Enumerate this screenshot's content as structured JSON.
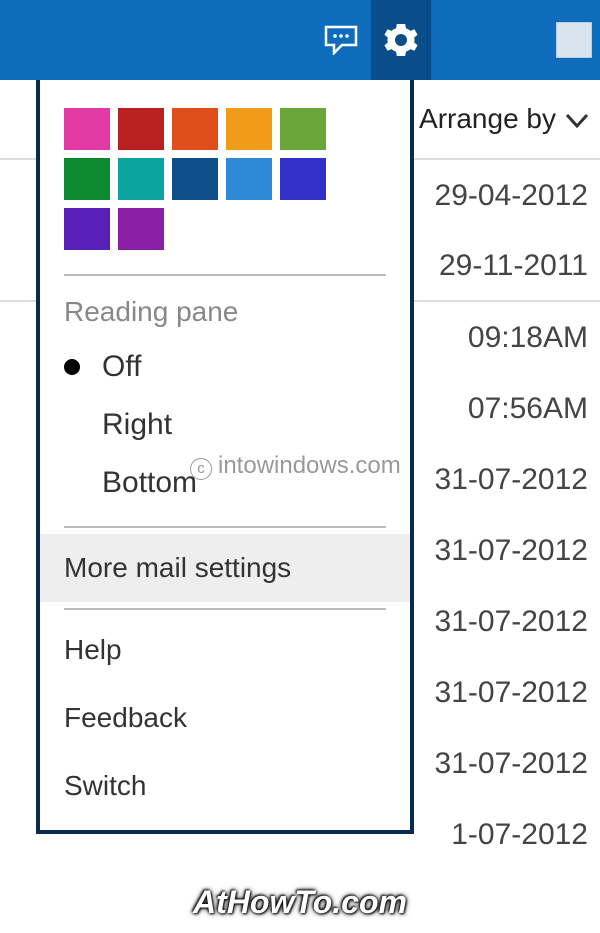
{
  "header": {
    "accent": "#0f6cbd",
    "accent_active": "#0a4d8c"
  },
  "arrange_by": {
    "label": "Arrange by"
  },
  "mail_list": {
    "rows": [
      "29-04-2012",
      "29-11-2011",
      "09:18AM",
      "07:56AM",
      "31-07-2012",
      "31-07-2012",
      "31-07-2012",
      "31-07-2012",
      "31-07-2012",
      "1-07-2012"
    ]
  },
  "settings_menu": {
    "theme_colors": [
      "#e23aa5",
      "#b92020",
      "#e04e1c",
      "#f19b1a",
      "#6aa53a",
      "#0d8a2e",
      "#0aa39e",
      "#0e4f8a",
      "#2f8ad6",
      "#3131c9",
      "#5a1eb9",
      "#8a1ea5"
    ],
    "reading_pane": {
      "title": "Reading pane",
      "options": {
        "off": "Off",
        "right": "Right",
        "bottom": "Bottom"
      },
      "selected": "off"
    },
    "more_settings": "More mail settings",
    "help": "Help",
    "feedback": "Feedback",
    "switch": "Switch"
  },
  "watermarks": {
    "w1": "intowindows.com",
    "w2": "AtHowTo.com"
  }
}
